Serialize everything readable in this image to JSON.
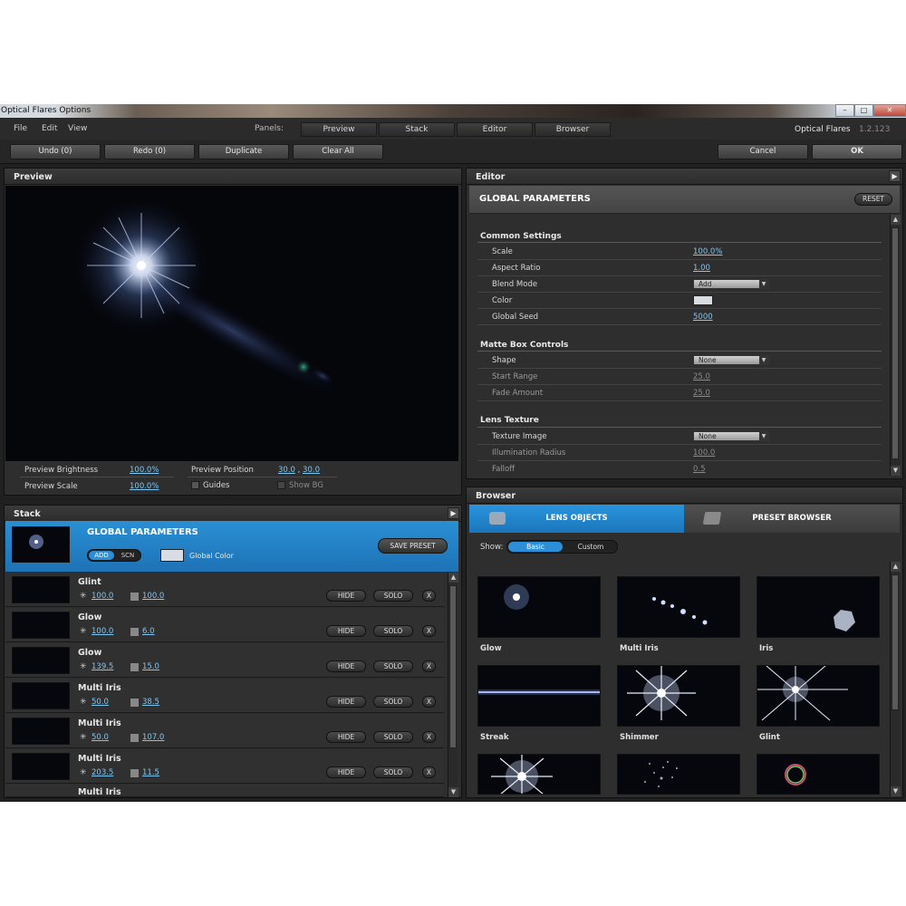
{
  "window": {
    "title": "Optical Flares Options"
  },
  "menu": [
    "File",
    "Edit",
    "View"
  ],
  "panels": {
    "label": "Panels:",
    "tabs": [
      "Preview",
      "Stack",
      "Editor",
      "Browser"
    ]
  },
  "app": {
    "name": "Optical Flares",
    "version": "1.2.123"
  },
  "toolbar": {
    "undo": "Undo (0)",
    "redo": "Redo (0)",
    "duplicate": "Duplicate",
    "clear_all": "Clear All",
    "cancel": "Cancel",
    "ok": "OK"
  },
  "preview": {
    "title": "Preview",
    "brightness_label": "Preview Brightness",
    "brightness": "100.0%",
    "scale_label": "Preview Scale",
    "scale": "100.0%",
    "position_label": "Preview Position",
    "position_x": "30.0",
    "position_sep": ",",
    "position_y": "30.0",
    "guides": "Guides",
    "show_bg": "Show BG"
  },
  "stack": {
    "title": "Stack",
    "global": {
      "title": "GLOBAL PARAMETERS",
      "add": "ADD",
      "scn": "SCN",
      "global_color": "Global Color",
      "save_preset": "SAVE PRESET"
    },
    "rows": [
      {
        "name": "Glint",
        "v1": "100.0",
        "v2": "100.0"
      },
      {
        "name": "Glow",
        "v1": "100.0",
        "v2": "6.0"
      },
      {
        "name": "Glow",
        "v1": "139.5",
        "v2": "15.0"
      },
      {
        "name": "Multi Iris",
        "v1": "50.0",
        "v2": "38.5"
      },
      {
        "name": "Multi Iris",
        "v1": "50.0",
        "v2": "107.0"
      },
      {
        "name": "Multi Iris",
        "v1": "203.5",
        "v2": "11.5"
      }
    ],
    "partial_row": "Multi Iris",
    "hide": "HIDE",
    "solo": "SOLO",
    "x": "X"
  },
  "editor": {
    "title": "Editor",
    "section_title": "GLOBAL PARAMETERS",
    "reset": "RESET",
    "common": {
      "title": "Common Settings",
      "scale_label": "Scale",
      "scale": "100.0%",
      "aspect_label": "Aspect Ratio",
      "aspect": "1.00",
      "blend_label": "Blend Mode",
      "blend": "Add",
      "color_label": "Color",
      "seed_label": "Global Seed",
      "seed": "5000"
    },
    "matte": {
      "title": "Matte Box Controls",
      "shape_label": "Shape",
      "shape": "None",
      "start_label": "Start Range",
      "start": "25.0",
      "fade_label": "Fade Amount",
      "fade": "25.0"
    },
    "texture": {
      "title": "Lens Texture",
      "image_label": "Texture Image",
      "image": "None",
      "illum_label": "Illumination Radius",
      "illum": "100.0",
      "falloff_label": "Falloff",
      "falloff": "0.5"
    }
  },
  "browser": {
    "title": "Browser",
    "tab_lens": "LENS OBJECTS",
    "tab_preset": "PRESET BROWSER",
    "show_label": "Show:",
    "basic": "Basic",
    "custom": "Custom",
    "items": [
      "Glow",
      "Multi Iris",
      "Iris",
      "Streak",
      "Shimmer",
      "Glint"
    ]
  },
  "colors": {
    "accent": "#1d7fc5",
    "link": "#7fc6f2",
    "panel": "#2e2e2e"
  }
}
